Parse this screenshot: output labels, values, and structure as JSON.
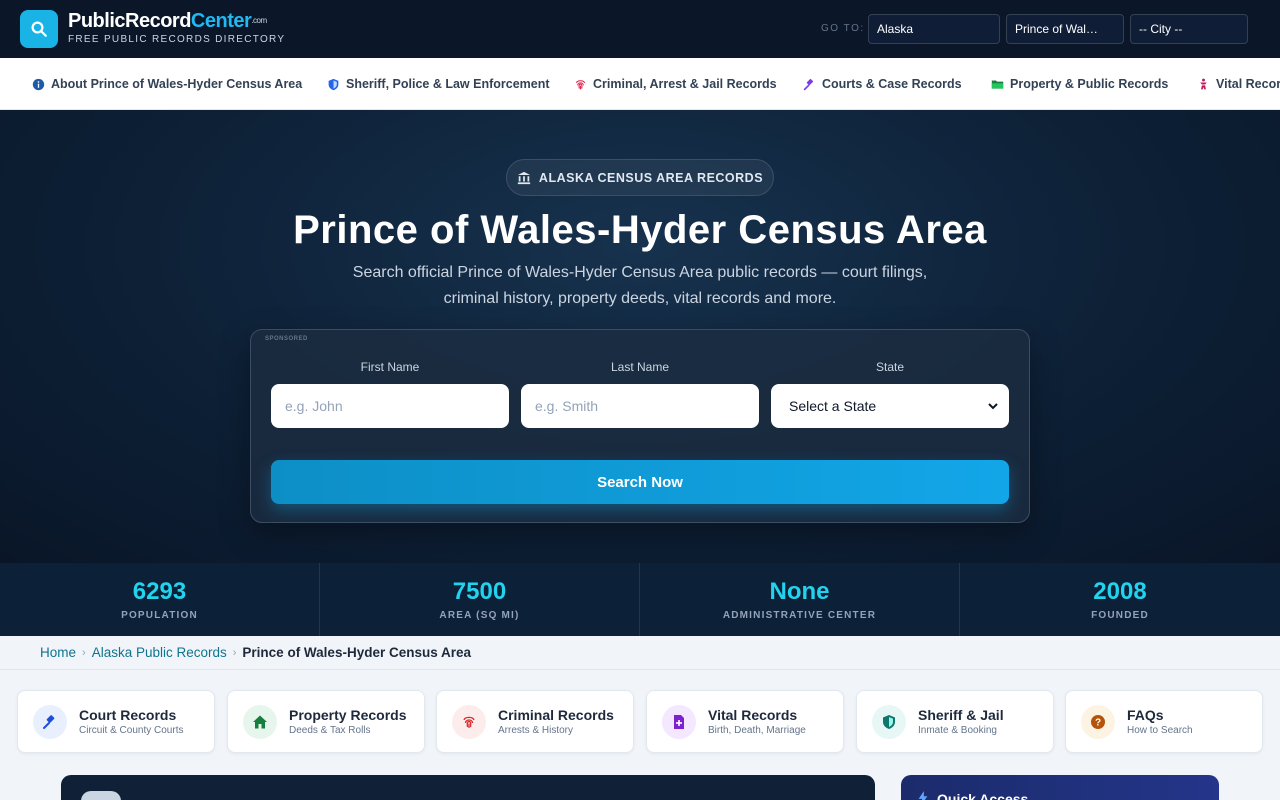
{
  "header": {
    "brand_main": "PublicRecord",
    "brand_accent": "Center",
    "brand_suffix": ".com",
    "tagline": "FREE PUBLIC RECORDS DIRECTORY",
    "goto_label": "GO TO:",
    "goto_state": "Alaska",
    "goto_county": "Prince of Wal…",
    "goto_city": "-- City --"
  },
  "nav": [
    {
      "label": "About Prince of Wales-Hyder Census Area",
      "icon": "info-icon"
    },
    {
      "label": "Sheriff, Police & Law Enforcement",
      "icon": "shield-icon"
    },
    {
      "label": "Criminal, Arrest & Jail Records",
      "icon": "fingerprint-icon"
    },
    {
      "label": "Courts & Case Records",
      "icon": "gavel-icon"
    },
    {
      "label": "Property & Public Records",
      "icon": "folder-icon"
    },
    {
      "label": "Vital Records",
      "icon": "vital-icon"
    }
  ],
  "hero": {
    "badge": "ALASKA CENSUS AREA RECORDS",
    "title": "Prince of Wales-Hyder Census Area",
    "subtitle": "Search official Prince of Wales-Hyder Census Area public records — court filings, criminal history, property deeds, vital records and more."
  },
  "search": {
    "sponsored": "SPONSORED",
    "first_name_label": "First Name",
    "first_name_placeholder": "e.g. John",
    "last_name_label": "Last Name",
    "last_name_placeholder": "e.g. Smith",
    "state_label": "State",
    "state_value": "Select a State",
    "button": "Search Now"
  },
  "stats": [
    {
      "value": "6293",
      "label": "POPULATION"
    },
    {
      "value": "7500",
      "label": "AREA (SQ MI)"
    },
    {
      "value": "None",
      "label": "ADMINISTRATIVE CENTER"
    },
    {
      "value": "2008",
      "label": "FOUNDED"
    }
  ],
  "breadcrumb": {
    "home": "Home",
    "state": "Alaska Public Records",
    "current": "Prince of Wales-Hyder Census Area"
  },
  "categories": [
    {
      "title": "Court Records",
      "subtitle": "Circuit & County Courts",
      "icon": "gavel-icon",
      "color": "#1d4ed8",
      "bg": "#e8efff"
    },
    {
      "title": "Property Records",
      "subtitle": "Deeds & Tax Rolls",
      "icon": "home-icon",
      "color": "#15803d",
      "bg": "#e7f6ec"
    },
    {
      "title": "Criminal Records",
      "subtitle": "Arrests & History",
      "icon": "fingerprint-icon",
      "color": "#dc2626",
      "bg": "#fdecec"
    },
    {
      "title": "Vital Records",
      "subtitle": "Birth, Death, Marriage",
      "icon": "document-plus-icon",
      "color": "#7e22ce",
      "bg": "#f3e8ff"
    },
    {
      "title": "Sheriff & Jail",
      "subtitle": "Inmate & Booking",
      "icon": "shield-icon",
      "color": "#0f766e",
      "bg": "#e6f7f5"
    },
    {
      "title": "FAQs",
      "subtitle": "How to Search",
      "icon": "question-icon",
      "color": "#b45309",
      "bg": "#fdf3e3"
    }
  ],
  "quick_access": {
    "title": "Quick Access"
  }
}
